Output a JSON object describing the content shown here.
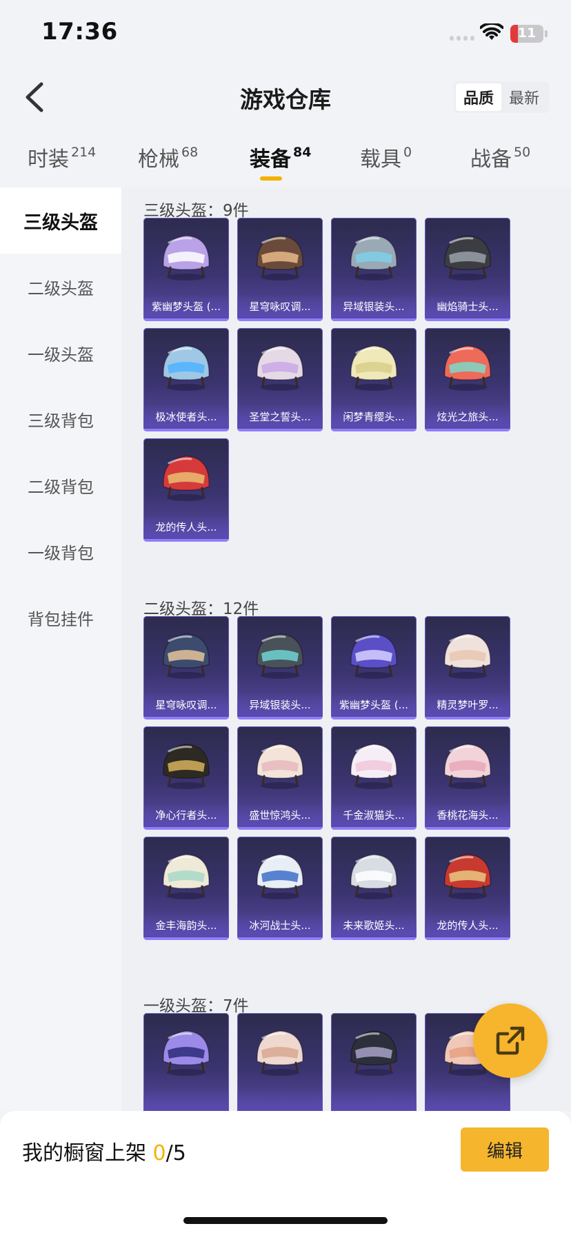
{
  "status_bar": {
    "time": "17:36",
    "battery": "11"
  },
  "header": {
    "title": "游戏仓库",
    "sort_options": [
      "品质",
      "最新"
    ],
    "sort_active": "品质"
  },
  "tabs": [
    {
      "label": "时装",
      "count": "214"
    },
    {
      "label": "枪械",
      "count": "68"
    },
    {
      "label": "装备",
      "count": "84"
    },
    {
      "label": "载具",
      "count": "0"
    },
    {
      "label": "战备",
      "count": "50"
    }
  ],
  "active_tab": "装备",
  "sidebar": [
    "三级头盔",
    "二级头盔",
    "一级头盔",
    "三级背包",
    "二级背包",
    "一级背包",
    "背包挂件"
  ],
  "sidebar_active": "三级头盔",
  "sections": [
    {
      "title": "三级头盔：9件",
      "items": [
        {
          "label": "紫幽梦头盔 (...",
          "color": "#b9a2e8",
          "accent": "#ffffff"
        },
        {
          "label": "星穹咏叹调...",
          "color": "#6a4a3a",
          "accent": "#e7b98a"
        },
        {
          "label": "异域银装头...",
          "color": "#9aa9b6",
          "accent": "#7ed0e8"
        },
        {
          "label": "幽焰骑士头...",
          "color": "#3b3d42",
          "accent": "#9aa0a8"
        },
        {
          "label": "极冰使者头...",
          "color": "#9fc8e6",
          "accent": "#4fb3ff"
        },
        {
          "label": "圣堂之誓头...",
          "color": "#e6d9e6",
          "accent": "#c9a7e6"
        },
        {
          "label": "闲梦青缨头...",
          "color": "#efe8b9",
          "accent": "#d8cf8a"
        },
        {
          "label": "炫光之旅头...",
          "color": "#ee6a5a",
          "accent": "#7cd8c8"
        },
        {
          "label": "龙的传人头...",
          "color": "#d63a3a",
          "accent": "#e8c070"
        }
      ]
    },
    {
      "title": "二级头盔：12件",
      "items": [
        {
          "label": "星穹咏叹调...",
          "color": "#3d4b6e",
          "accent": "#e5c39a"
        },
        {
          "label": "异域银装头...",
          "color": "#4a5259",
          "accent": "#6fd3d3"
        },
        {
          "label": "紫幽梦头盔 (...",
          "color": "#5a4fc7",
          "accent": "#d8d0ff"
        },
        {
          "label": "精灵梦叶罗...",
          "color": "#efe2dc",
          "accent": "#e8c7b0"
        },
        {
          "label": "净心行者头...",
          "color": "#2d2a24",
          "accent": "#d6b25a"
        },
        {
          "label": "盛世惊鸿头...",
          "color": "#f3e3d8",
          "accent": "#e6b8c0"
        },
        {
          "label": "千金淑猫头...",
          "color": "#f6eef6",
          "accent": "#f1c7d8"
        },
        {
          "label": "香桃花海头...",
          "color": "#f3d3da",
          "accent": "#e8a8b8"
        },
        {
          "label": "金丰海韵头...",
          "color": "#efe9d8",
          "accent": "#a8d8c8"
        },
        {
          "label": "冰河战士头...",
          "color": "#e8eef6",
          "accent": "#3d6fc8"
        },
        {
          "label": "未来歌姬头...",
          "color": "#d8dde3",
          "accent": "#ffffff"
        },
        {
          "label": "龙的传人头...",
          "color": "#c83a30",
          "accent": "#e8c880"
        }
      ]
    },
    {
      "title": "一级头盔：7件",
      "items": [
        {
          "label": "",
          "color": "#9c8ae8",
          "accent": "#2d2a7a"
        },
        {
          "label": "",
          "color": "#efd8cf",
          "accent": "#d8a890"
        },
        {
          "label": "",
          "color": "#2d2f3a",
          "accent": "#a8a0c8"
        },
        {
          "label": "",
          "color": "#f0c8b8",
          "accent": "#e8a080"
        }
      ]
    }
  ],
  "bottom": {
    "shelf_label": "我的橱窗上架",
    "shelf_used": "0",
    "shelf_total": "/5",
    "edit_label": "编辑"
  }
}
